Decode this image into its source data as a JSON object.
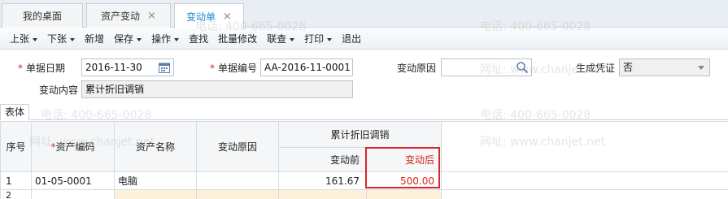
{
  "tabs": [
    {
      "label": "我的桌面",
      "closable": false,
      "active": false
    },
    {
      "label": "资产变动",
      "closable": true,
      "active": false
    },
    {
      "label": "变动单",
      "closable": true,
      "active": true
    }
  ],
  "toolbar": {
    "items": [
      {
        "label": "上张",
        "dropdown": true
      },
      {
        "label": "下张",
        "dropdown": true
      },
      {
        "label": "新增",
        "dropdown": false
      },
      {
        "label": "保存",
        "dropdown": true
      },
      {
        "label": "操作",
        "dropdown": true
      },
      {
        "label": "查找",
        "dropdown": false
      },
      {
        "label": "批量修改",
        "dropdown": false
      },
      {
        "label": "联查",
        "dropdown": true
      },
      {
        "label": "打印",
        "dropdown": true
      },
      {
        "label": "退出",
        "dropdown": false
      }
    ]
  },
  "form": {
    "doc_date_label": "单据日期",
    "doc_date_value": "2016-11-30",
    "doc_no_label": "单据编号",
    "doc_no_value": "AA-2016-11-0001",
    "reason_label": "变动原因",
    "reason_value": "",
    "voucher_label": "生成凭证",
    "voucher_value": "否",
    "content_label": "变动内容",
    "content_value": "累计折旧调销"
  },
  "body_tab": "表体",
  "grid": {
    "headers": {
      "seq": "序号",
      "asset_code": "资产编码",
      "asset_name": "资产名称",
      "reason": "变动原因",
      "group": "累计折旧调销",
      "before": "变动前",
      "after": "变动后"
    },
    "rows": [
      {
        "seq": "1",
        "asset_code": "01-05-0001",
        "asset_name": "电脑",
        "reason": "",
        "before": "161.67",
        "after": "500.00"
      },
      {
        "seq": "2",
        "asset_code": "",
        "asset_name": "",
        "reason": "",
        "before": "",
        "after": ""
      }
    ]
  },
  "watermark": {
    "phone": "电话: 400-665-0028",
    "site": "网址: www.chanjet.net"
  },
  "colors": {
    "accent": "#1a8ccf",
    "required": "#d9261c",
    "highlight_box": "#d9262b",
    "row_shade": "#fdf1dc"
  }
}
